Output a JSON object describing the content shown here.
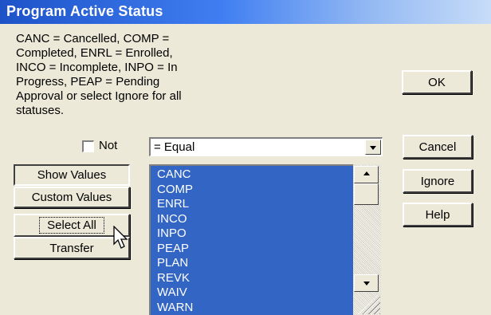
{
  "window": {
    "title": "Program Active Status"
  },
  "description": "CANC = Cancelled, COMP =\nCompleted, ENRL = Enrolled,\nINCO = Incomplete, INPO = In\nProgress, PEAP = Pending\nApproval or select Ignore for all\nstatuses.",
  "buttons": {
    "ok": "OK",
    "cancel": "Cancel",
    "ignore": "Ignore",
    "help": "Help",
    "show_values": "Show Values",
    "custom_values": "Custom Values",
    "select_all": "Select All",
    "transfer": "Transfer"
  },
  "not_checkbox": {
    "label": "Not",
    "checked": false
  },
  "operator": {
    "selected": "= Equal"
  },
  "values_list": [
    "CANC",
    "COMP",
    "ENRL",
    "INCO",
    "INPO",
    "PEAP",
    "PLAN",
    "REVK",
    "WAIV",
    "WARN"
  ],
  "colors": {
    "selection": "#3265c4",
    "title_start": "#1e53c8",
    "face": "#ece9d8"
  },
  "icons": [
    "dropdown-arrow-icon",
    "scroll-up-icon",
    "scroll-down-icon",
    "resize-grip-icon",
    "mouse-pointer-icon"
  ]
}
